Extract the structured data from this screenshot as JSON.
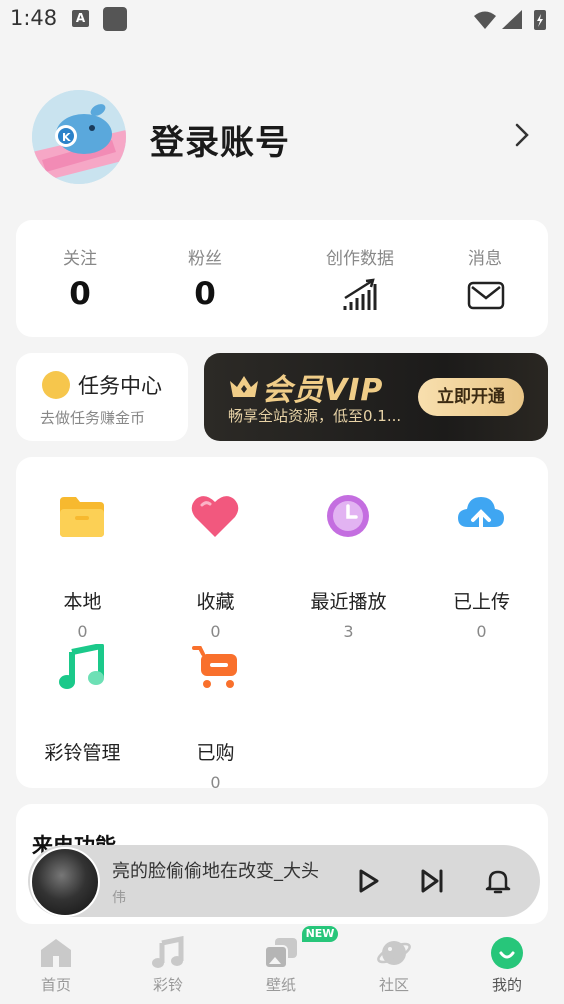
{
  "status_bar": {
    "time": "1:48",
    "a_icon_letter": "A"
  },
  "profile": {
    "name": "登录账号"
  },
  "stats": [
    {
      "label": "关注",
      "value": "0"
    },
    {
      "label": "粉丝",
      "value": "0"
    },
    {
      "label": "创作数据",
      "icon": "bar-chart-icon"
    },
    {
      "label": "消息",
      "icon": "envelope-icon"
    }
  ],
  "task_center": {
    "title": "任务中心",
    "subtitle": "去做任务赚金币"
  },
  "vip": {
    "title": "会员VIP",
    "subtitle": "畅享全站资源，低至0.1...",
    "button": "立即开通"
  },
  "grid": [
    {
      "label": "本地",
      "count": "0",
      "icon": "folder-icon"
    },
    {
      "label": "收藏",
      "count": "0",
      "icon": "heart-icon"
    },
    {
      "label": "最近播放",
      "count": "3",
      "icon": "clock-icon"
    },
    {
      "label": "已上传",
      "count": "0",
      "icon": "cloud-upload-icon"
    },
    {
      "label": "彩铃管理",
      "icon": "music-note-icon"
    },
    {
      "label": "已购",
      "count": "0",
      "icon": "cart-icon"
    }
  ],
  "features": {
    "title": "来电功能"
  },
  "player": {
    "song": "亮的脸偷偷地在改变_大头",
    "artist": "伟"
  },
  "tabbar": {
    "items": [
      {
        "label": "首页",
        "icon": "home-icon"
      },
      {
        "label": "彩铃",
        "icon": "music-icon"
      },
      {
        "label": "壁纸",
        "icon": "wallpaper-icon"
      },
      {
        "label": "社区",
        "icon": "planet-icon"
      },
      {
        "label": "我的",
        "icon": "profile-icon"
      }
    ],
    "badge": "NEW"
  },
  "colors": {
    "accent": "#27c67a",
    "vip_gold": "#f0cd88"
  }
}
